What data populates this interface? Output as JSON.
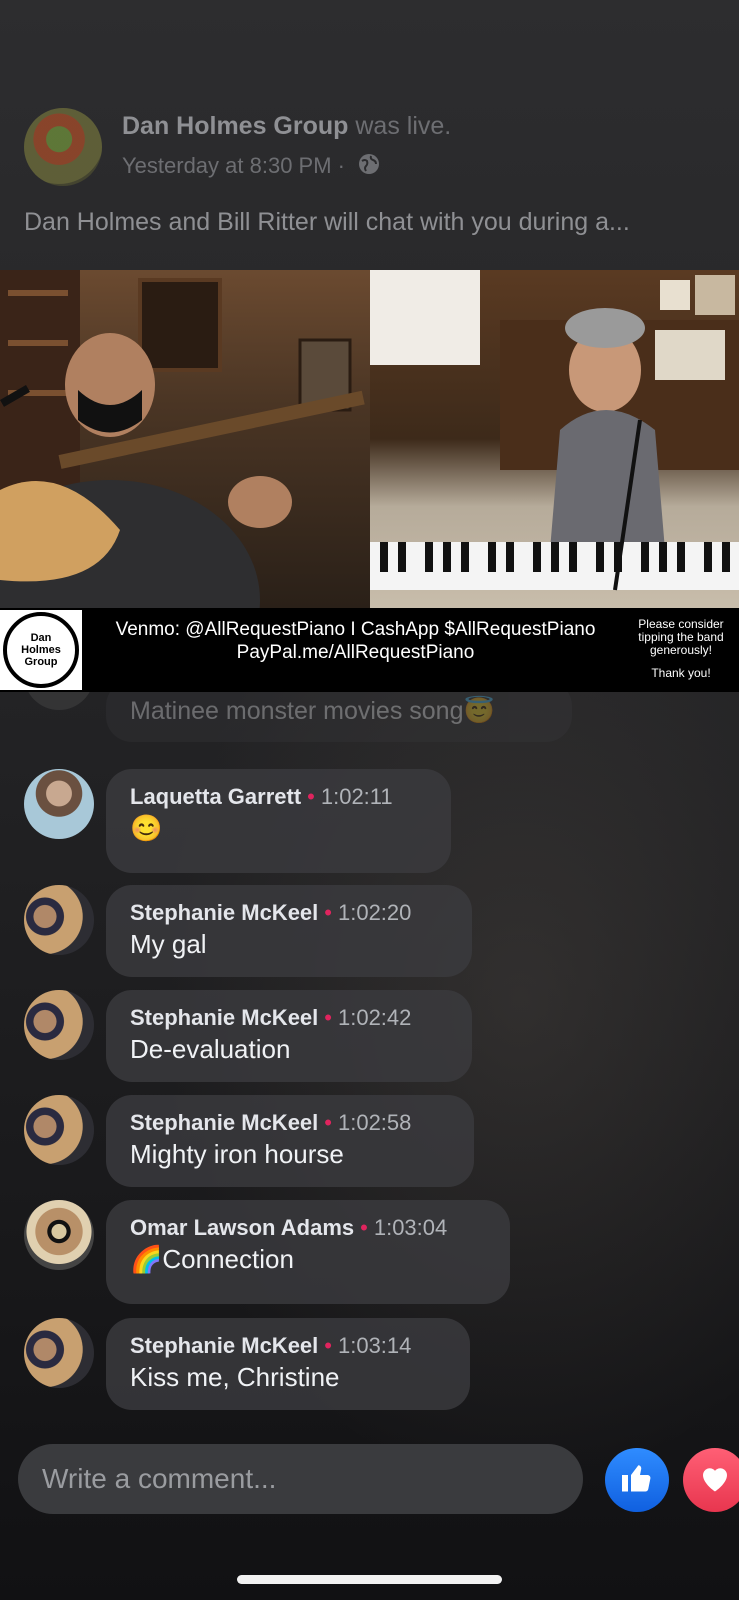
{
  "post": {
    "page_name": "Dan Holmes Group",
    "status_suffix": " was live.",
    "timestamp": "Yesterday at 8:30 PM",
    "separator": "·",
    "privacy_icon": "globe-icon",
    "caption": "Dan Holmes and Bill Ritter will chat with you during a..."
  },
  "video": {
    "logo_lines": [
      "Dan",
      "Holmes",
      "Group"
    ],
    "tip_line1": "Venmo: @AllRequestPiano  I  CashApp $AllRequestPiano",
    "tip_line2": "PayPal.me/AllRequestPiano",
    "tip_note": "Please consider tipping the band generously!",
    "tip_thanks": "Thank you!"
  },
  "comments": [
    {
      "name": "",
      "time": "",
      "text": "Matinee monster movies song😇",
      "faded": true
    },
    {
      "name": "Laquetta Garrett",
      "time": "1:02:11",
      "text": "😊"
    },
    {
      "name": "Stephanie McKeel",
      "time": "1:02:20",
      "text": "My gal"
    },
    {
      "name": "Stephanie McKeel",
      "time": "1:02:42",
      "text": "De-evaluation"
    },
    {
      "name": "Stephanie McKeel",
      "time": "1:02:58",
      "text": "Mighty iron hourse"
    },
    {
      "name": "Omar Lawson Adams",
      "time": "1:03:04",
      "text": "🌈Connection"
    },
    {
      "name": "Stephanie McKeel",
      "time": "1:03:14",
      "text": "Kiss me, Christine"
    }
  ],
  "composer": {
    "placeholder": "Write a comment..."
  },
  "reactions": {
    "like_icon": "thumbs-up-icon",
    "love_icon": "heart-icon"
  },
  "colors": {
    "like_blue": "#1877f2",
    "love_red": "#f0284a",
    "dot_red": "#e0245e"
  }
}
